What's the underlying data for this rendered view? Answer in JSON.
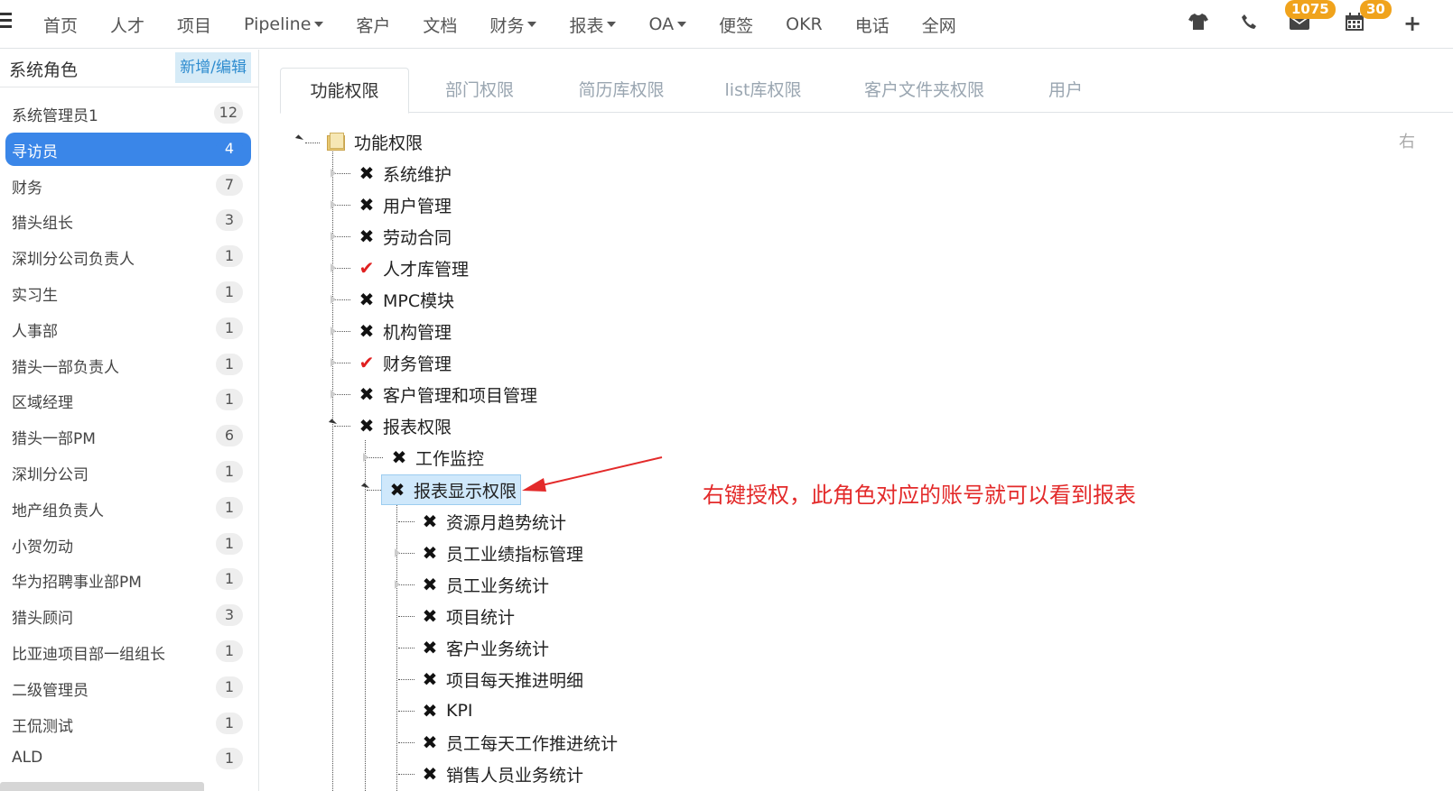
{
  "nav": {
    "items": [
      {
        "label": "首页",
        "dropdown": false
      },
      {
        "label": "人才",
        "dropdown": false
      },
      {
        "label": "项目",
        "dropdown": false
      },
      {
        "label": "Pipeline",
        "dropdown": true
      },
      {
        "label": "客户",
        "dropdown": false
      },
      {
        "label": "文档",
        "dropdown": false
      },
      {
        "label": "财务",
        "dropdown": true
      },
      {
        "label": "报表",
        "dropdown": true
      },
      {
        "label": "OA",
        "dropdown": true
      },
      {
        "label": "便签",
        "dropdown": false
      },
      {
        "label": "OKR",
        "dropdown": false
      },
      {
        "label": "电话",
        "dropdown": false
      },
      {
        "label": "全网",
        "dropdown": false
      }
    ],
    "icons": [
      "shirt-icon",
      "phone-icon",
      "mail-icon",
      "calendar-icon",
      "plus-icon"
    ],
    "mail_badge": "1075",
    "calendar_badge": "30",
    "badge_color": "#f0a31c"
  },
  "roles": {
    "title": "系统角色",
    "add_edit_label": "新增/编辑",
    "items": [
      {
        "name": "系统管理员1",
        "count": "12"
      },
      {
        "name": "寻访员",
        "count": "4",
        "active": true
      },
      {
        "name": "财务",
        "count": "7"
      },
      {
        "name": "猎头组长",
        "count": "3"
      },
      {
        "name": "深圳分公司负责人",
        "count": "1"
      },
      {
        "name": "实习生",
        "count": "1"
      },
      {
        "name": "人事部",
        "count": "1"
      },
      {
        "name": "猎头一部负责人",
        "count": "1"
      },
      {
        "name": "区域经理",
        "count": "1"
      },
      {
        "name": "猎头一部PM",
        "count": "6"
      },
      {
        "name": "深圳分公司",
        "count": "1"
      },
      {
        "name": "地产组负责人",
        "count": "1"
      },
      {
        "name": "小贺勿动",
        "count": "1"
      },
      {
        "name": "华为招聘事业部PM",
        "count": "1"
      },
      {
        "name": "猎头顾问",
        "count": "3"
      },
      {
        "name": "比亚迪项目部一组组长",
        "count": "1"
      },
      {
        "name": "二级管理员",
        "count": "1"
      },
      {
        "name": "王侃测试",
        "count": "1"
      },
      {
        "name": "ALD",
        "count": "1"
      }
    ],
    "active_color": "#3a86e8"
  },
  "tabs": [
    {
      "label": "功能权限",
      "active": true
    },
    {
      "label": "部门权限"
    },
    {
      "label": "简历库权限"
    },
    {
      "label": "list库权限"
    },
    {
      "label": "客户文件夹权限"
    },
    {
      "label": "用户"
    }
  ],
  "right_hint": "右",
  "tree": {
    "root": "功能权限",
    "nodes": [
      {
        "label": "系统维护",
        "checked": false
      },
      {
        "label": "用户管理",
        "checked": false
      },
      {
        "label": "劳动合同",
        "checked": false
      },
      {
        "label": "人才库管理",
        "checked": true
      },
      {
        "label": "MPC模块",
        "checked": false
      },
      {
        "label": "机构管理",
        "checked": false
      },
      {
        "label": "财务管理",
        "checked": true
      },
      {
        "label": "客户管理和项目管理",
        "checked": false
      },
      {
        "label": "报表权限",
        "checked": false,
        "expanded": true
      }
    ],
    "report_children": [
      {
        "label": "工作监控",
        "checked": false
      },
      {
        "label": "报表显示权限",
        "checked": false,
        "selected": true,
        "expanded": true
      }
    ],
    "display_children": [
      {
        "label": "资源月趋势统计",
        "checked": false
      },
      {
        "label": "员工业绩指标管理",
        "checked": false
      },
      {
        "label": "员工业务统计",
        "checked": false
      },
      {
        "label": "项目统计",
        "checked": false
      },
      {
        "label": "客户业务统计",
        "checked": false
      },
      {
        "label": "项目每天推进明细",
        "checked": false
      },
      {
        "label": "KPI",
        "checked": false
      },
      {
        "label": "员工每天工作推进统计",
        "checked": false
      },
      {
        "label": "销售人员业务统计",
        "checked": false
      }
    ],
    "check_color": "#e02020"
  },
  "annotation": {
    "text": "右键授权，此角色对应的账号就可以看到报表",
    "color": "#e32a2a"
  }
}
